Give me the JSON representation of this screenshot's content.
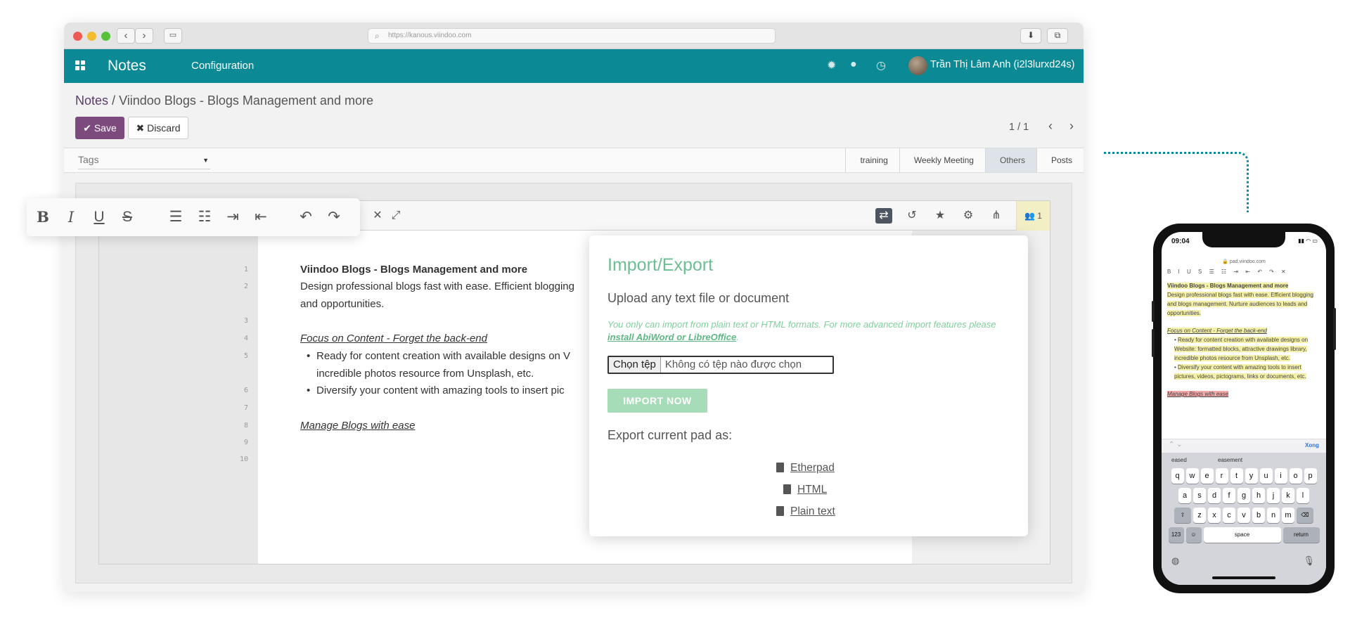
{
  "browser": {
    "url": "https://kanous.viindoo.com",
    "nav_back": "‹",
    "nav_forward": "›"
  },
  "topbar": {
    "app_name": "Notes",
    "menu_configuration": "Configuration",
    "user_name": "Trần Thị Lâm Anh (i2l3lurxd24s)"
  },
  "breadcrumb": {
    "root": "Notes",
    "separator": "/",
    "current": "Viindoo Blogs - Blogs Management and more"
  },
  "actions": {
    "save_label": "Save",
    "discard_label": "Discard"
  },
  "pager": {
    "value": "1 / 1"
  },
  "tags_field": {
    "placeholder": "Tags"
  },
  "stages": [
    "training",
    "Weekly Meeting",
    "Others",
    "Posts"
  ],
  "active_stage": "Others",
  "editor": {
    "user_count": "1",
    "line_numbers": [
      "1",
      "2",
      "3",
      "4",
      "5",
      "6",
      "7",
      "8",
      "9",
      "10"
    ],
    "lines": {
      "title": "Viindoo Blogs - Blogs Management and more",
      "desc1": "Design professional blogs fast with ease. Efficient blogging",
      "desc2": "and opportunities.",
      "focus": "Focus on Content - Forget the back-end",
      "bullet1a": "Ready for content creation with available designs on V",
      "bullet1b": "incredible photos resource from Unsplash, etc.",
      "bullet2": "Diversify your content with amazing tools to insert pic",
      "manage": "Manage Blogs with ease"
    }
  },
  "import_dialog": {
    "title": "Import/Export",
    "upload_heading": "Upload any text file or document",
    "note_text": "You only can import from plain text or HTML formats. For more advanced import features please ",
    "note_link": "install AbiWord or LibreOffice",
    "note_end": ".",
    "file_choose": "Chọn tệp",
    "file_none": "Không có tệp nào được chọn",
    "import_button": "IMPORT NOW",
    "export_heading": "Export current pad as:",
    "export_etherpad": "Etherpad",
    "export_html": "HTML",
    "export_plain": "Plain text"
  },
  "phone": {
    "time": "09:04",
    "url": "pad.viindoo.com",
    "text": {
      "title": "Viindoo Blogs - Blogs Management and more",
      "desc": "Design professional blogs fast with ease. Efficient blogging and blogs management. Nurture audiences to leads and opportunities.",
      "focus": "Focus on Content - Forget the back-end",
      "bullet1": "Ready for content creation with available designs on Website: formatted blocks, attractive drawings library, incredible photos resource from Unsplash, etc.",
      "bullet2": "Diversify your content with amazing tools to insert pictures, videos, pictograms, links or documents, etc.",
      "manage": "Manage Blogs with ease"
    },
    "done": "Xong",
    "suggestions": [
      "eased",
      "easement"
    ],
    "rows": [
      [
        "q",
        "w",
        "e",
        "r",
        "t",
        "y",
        "u",
        "i",
        "o",
        "p"
      ],
      [
        "a",
        "s",
        "d",
        "f",
        "g",
        "h",
        "j",
        "k",
        "l"
      ],
      [
        "z",
        "x",
        "c",
        "v",
        "b",
        "n",
        "m"
      ]
    ],
    "key_123": "123",
    "key_space": "space",
    "key_return": "return"
  },
  "colors": {
    "brand_teal": "#0b8a96",
    "save_purple": "#7c4a7c",
    "dialog_green": "#6dbf93"
  }
}
